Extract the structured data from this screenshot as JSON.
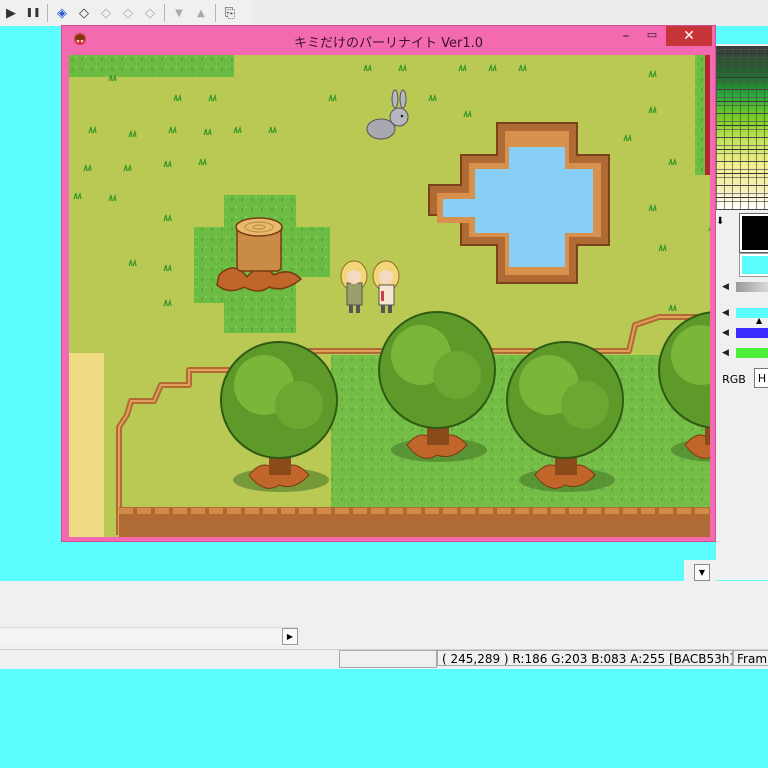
{
  "toolbar": {
    "buttons": [
      {
        "icon": "play-icon",
        "glyph": "▶"
      },
      {
        "icon": "pause-icon",
        "glyph": "❚❚"
      },
      {
        "icon": "layer-add-icon",
        "glyph": "◈"
      },
      {
        "icon": "layer-icon",
        "glyph": "◇"
      },
      {
        "icon": "layer-delete-icon",
        "glyph": "◇"
      },
      {
        "icon": "layer-star-icon",
        "glyph": "◇"
      },
      {
        "icon": "layer-settings-icon",
        "glyph": "◇"
      },
      {
        "icon": "arrow-down-icon",
        "glyph": "▼"
      },
      {
        "icon": "arrow-up-icon",
        "glyph": "▲"
      },
      {
        "icon": "export-icon",
        "glyph": "⎘"
      }
    ]
  },
  "game_window": {
    "title": "キミだけのパーリナイト  Ver1.0",
    "minimize": "–",
    "maximize": "▭",
    "close": "✕"
  },
  "palette": {
    "foreground_color": "#000000",
    "background_color": "#5cfdfd",
    "bars": [
      "#5cfdfd",
      "#3a2cff",
      "#4ef03a"
    ],
    "tab_rgb": "RGB",
    "tab_h": "H"
  },
  "status_bar": {
    "coords": "( 245,289 ) R:186 G:203 B:083 A:255  [BACB53h]",
    "frame": "Fram"
  },
  "colors": {
    "window_frame": "#f46ab1",
    "close_button": "#c7353b",
    "grass": "#b9c954",
    "water": "#89cff5",
    "canvas_bg": "#5cfdfd"
  }
}
